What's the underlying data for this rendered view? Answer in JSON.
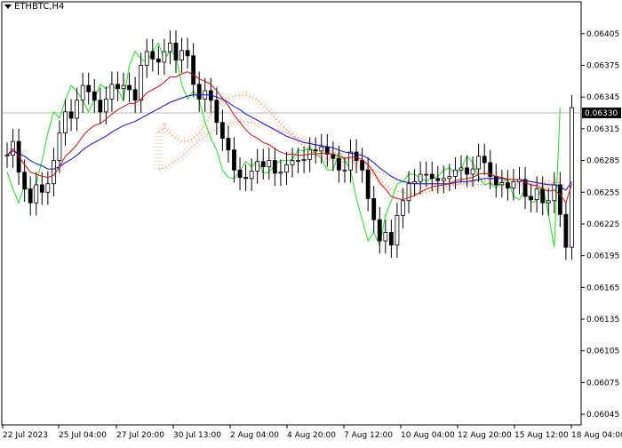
{
  "symbol_label": "ETHBTC,H4",
  "chart_data": {
    "type": "candlestick",
    "symbol": "ETHBTC",
    "timeframe": "H4",
    "current_price": "0.06330",
    "ylim": [
      0.06035,
      0.06425
    ],
    "y_ticks": [
      "0.06405",
      "0.06375",
      "0.06345",
      "0.06315",
      "0.06285",
      "0.06255",
      "0.06225",
      "0.06195",
      "0.06165",
      "0.06135",
      "0.06105",
      "0.06075",
      "0.06045"
    ],
    "x_ticks": [
      "22 Jul 2023",
      "25 Jul 04:00",
      "27 Jul 20:00",
      "30 Jul 13:00",
      "2 Aug 04:00",
      "4 Aug 20:00",
      "7 Aug 12:00",
      "10 Aug 04:00",
      "12 Aug 20:00",
      "15 Aug 12:00",
      "18 Aug 04:00"
    ],
    "close": [
      0.0629,
      0.06303,
      0.06274,
      0.06258,
      0.06245,
      0.06262,
      0.06255,
      0.06263,
      0.06285,
      0.06311,
      0.06331,
      0.06325,
      0.06342,
      0.06356,
      0.0635,
      0.06342,
      0.06331,
      0.06343,
      0.06357,
      0.06353,
      0.06356,
      0.06352,
      0.06342,
      0.06375,
      0.06388,
      0.06381,
      0.06378,
      0.06388,
      0.06396,
      0.0638,
      0.06389,
      0.06384,
      0.06357,
      0.06343,
      0.06351,
      0.06342,
      0.06321,
      0.06306,
      0.06295,
      0.06276,
      0.06269,
      0.06268,
      0.06275,
      0.06284,
      0.06279,
      0.06285,
      0.06273,
      0.06274,
      0.06281,
      0.06285,
      0.06285,
      0.06286,
      0.06295,
      0.06294,
      0.06298,
      0.06291,
      0.06287,
      0.06276,
      0.06276,
      0.06293,
      0.06285,
      0.06276,
      0.06249,
      0.06229,
      0.06209,
      0.06217,
      0.06205,
      0.06233,
      0.06247,
      0.06263,
      0.06265,
      0.06272,
      0.06272,
      0.06268,
      0.06266,
      0.06268,
      0.0627,
      0.06276,
      0.06278,
      0.06272,
      0.06277,
      0.06289,
      0.06283,
      0.0627,
      0.06262,
      0.06264,
      0.06259,
      0.06265,
      0.06267,
      0.06251,
      0.06248,
      0.06258,
      0.06245,
      0.06247,
      0.06262,
      0.06234,
      0.06203,
      0.06335
    ],
    "tenkan": [
      0.0629,
      0.06296,
      0.06289,
      0.06281,
      0.06274,
      0.06272,
      0.0627,
      0.06269,
      0.06271,
      0.06279,
      0.06289,
      0.06294,
      0.063,
      0.06308,
      0.06314,
      0.06318,
      0.0632,
      0.06324,
      0.06329,
      0.06333,
      0.06336,
      0.06339,
      0.06339,
      0.06343,
      0.06349,
      0.06352,
      0.06355,
      0.06359,
      0.06364,
      0.06364,
      0.06367,
      0.06369,
      0.06366,
      0.06362,
      0.0636,
      0.06357,
      0.06351,
      0.06344,
      0.06337,
      0.06328,
      0.06321,
      0.06314,
      0.06309,
      0.06306,
      0.06302,
      0.063,
      0.06296,
      0.06293,
      0.06291,
      0.06291,
      0.0629,
      0.0629,
      0.06291,
      0.06291,
      0.06292,
      0.06292,
      0.06291,
      0.06289,
      0.06287,
      0.06288,
      0.06288,
      0.06286,
      0.06281,
      0.06274,
      0.06264,
      0.06258,
      0.06251,
      0.06249,
      0.06248,
      0.0625,
      0.06252,
      0.06255,
      0.06258,
      0.0626,
      0.06261,
      0.06262,
      0.06263,
      0.06266,
      0.06267,
      0.06268,
      0.06269,
      0.06272,
      0.06273,
      0.06272,
      0.0627,
      0.06269,
      0.06267,
      0.06267,
      0.06267,
      0.06264,
      0.06262,
      0.06261,
      0.06258,
      0.06256,
      0.06257,
      0.06253,
      0.06245,
      0.06263
    ],
    "kijun": [
      0.0629,
      0.06294,
      0.06292,
      0.06289,
      0.06285,
      0.06282,
      0.0628,
      0.06277,
      0.06277,
      0.06279,
      0.06283,
      0.06286,
      0.0629,
      0.06295,
      0.06299,
      0.06302,
      0.06305,
      0.06308,
      0.06312,
      0.06315,
      0.06318,
      0.0632,
      0.06322,
      0.06325,
      0.06328,
      0.06331,
      0.06334,
      0.06337,
      0.0634,
      0.06342,
      0.06344,
      0.06346,
      0.06347,
      0.06347,
      0.06347,
      0.06347,
      0.06345,
      0.06343,
      0.0634,
      0.06336,
      0.06333,
      0.06329,
      0.06326,
      0.06323,
      0.0632,
      0.06317,
      0.06314,
      0.06311,
      0.06308,
      0.06306,
      0.06304,
      0.06302,
      0.06301,
      0.063,
      0.06299,
      0.06298,
      0.06297,
      0.06295,
      0.06293,
      0.06292,
      0.06291,
      0.0629,
      0.06287,
      0.06283,
      0.06278,
      0.06274,
      0.0627,
      0.06267,
      0.06265,
      0.06264,
      0.06263,
      0.06263,
      0.06263,
      0.06263,
      0.06263,
      0.06263,
      0.06263,
      0.06264,
      0.06265,
      0.06265,
      0.06266,
      0.06267,
      0.06268,
      0.06268,
      0.06268,
      0.06268,
      0.06267,
      0.06267,
      0.06267,
      0.06266,
      0.06265,
      0.06264,
      0.06263,
      0.06262,
      0.06262,
      0.0626,
      0.06257,
      0.06265
    ],
    "chikou": [
      0.06303,
      0.06274,
      0.06258,
      0.06245,
      0.06262,
      0.06255,
      0.06263,
      0.06285,
      0.06311,
      0.06331,
      0.06325,
      0.06342,
      0.06356,
      0.0635,
      0.06342,
      0.06331,
      0.06343,
      0.06357,
      0.06353,
      0.06356,
      0.06352,
      0.06342,
      0.06375,
      0.06388,
      0.06381,
      0.06378,
      0.06388,
      0.06396,
      0.0638,
      0.06389,
      0.06384,
      0.06357,
      0.06343,
      0.06351,
      0.06342,
      0.06321,
      0.06306,
      0.06295,
      0.06276,
      0.06269,
      0.06268,
      0.06275,
      0.06284,
      0.06279,
      0.06285,
      0.06273,
      0.06274,
      0.06281,
      0.06285,
      0.06285,
      0.06286,
      0.06295,
      0.06294,
      0.06298,
      0.06291,
      0.06287,
      0.06276,
      0.06276,
      0.06293,
      0.06285,
      0.06276,
      0.06249,
      0.06229,
      0.06209,
      0.06217,
      0.06205,
      0.06233,
      0.06247,
      0.06263,
      0.06265,
      0.06272,
      0.06272,
      0.06268,
      0.06266,
      0.06268,
      0.0627,
      0.06276,
      0.06278,
      0.06272,
      0.06277,
      0.06289,
      0.06283,
      0.0627,
      0.06262,
      0.06264,
      0.06259,
      0.06265,
      0.06267,
      0.06251,
      0.06248,
      0.06258,
      0.06245,
      0.06247,
      0.06262,
      0.06234,
      0.06203,
      0.06335
    ],
    "senkou_a": [
      0.06312,
      0.06316,
      0.06311,
      0.06306,
      0.06303,
      0.06303,
      0.06306,
      0.06311,
      0.06319,
      0.06328,
      0.06335,
      0.06341,
      0.06344,
      0.06346,
      0.06347,
      0.06347,
      0.06345,
      0.06342,
      0.06337,
      0.06332,
      0.06326,
      0.0632,
      0.06314,
      0.06309,
      0.06303,
      0.06299,
      0.06294,
      0.06291,
      0.06289,
      0.06286,
      0.06285,
      0.06284,
      0.06284,
      0.06284,
      0.06282,
      0.0628,
      0.06276,
      0.06272,
      0.06267,
      0.06262,
      0.06258,
      0.06256,
      0.06255,
      0.06254,
      0.06254,
      0.06254,
      0.06255,
      0.06256,
      0.06258,
      0.06259,
      0.06261,
      0.06262,
      0.06263,
      0.06264,
      0.06265,
      0.06266,
      0.06266,
      0.06267,
      0.06268,
      0.06268,
      0.06268,
      0.06267,
      0.06266,
      0.06265,
      0.06265,
      0.06264,
      0.06264,
      0.06263,
      0.06264,
      0.06264
    ],
    "senkou_b": [
      0.06276,
      0.06278,
      0.06281,
      0.06285,
      0.06289,
      0.06294,
      0.06299,
      0.06304,
      0.06308,
      0.06312,
      0.06315,
      0.06318,
      0.0632,
      0.06321,
      0.06322,
      0.06322,
      0.06321,
      0.0632,
      0.06319,
      0.06317,
      0.06315,
      0.06313,
      0.06311,
      0.06309,
      0.06306,
      0.06304,
      0.06302,
      0.063,
      0.06298,
      0.06296,
      0.06293,
      0.06291,
      0.06289,
      0.06286,
      0.06284,
      0.06281,
      0.06279,
      0.06276,
      0.06274,
      0.06272,
      0.0627,
      0.06268,
      0.06266,
      0.06265,
      0.06264,
      0.06263,
      0.06262,
      0.06262,
      0.06262,
      0.06262,
      0.06262,
      0.06262,
      0.06262,
      0.06262,
      0.06262,
      0.06262,
      0.06262,
      0.06262,
      0.06262,
      0.06262,
      0.06262,
      0.06262,
      0.06262,
      0.06262,
      0.06262,
      0.06262,
      0.06262,
      0.06262,
      0.06262,
      0.06262
    ]
  }
}
